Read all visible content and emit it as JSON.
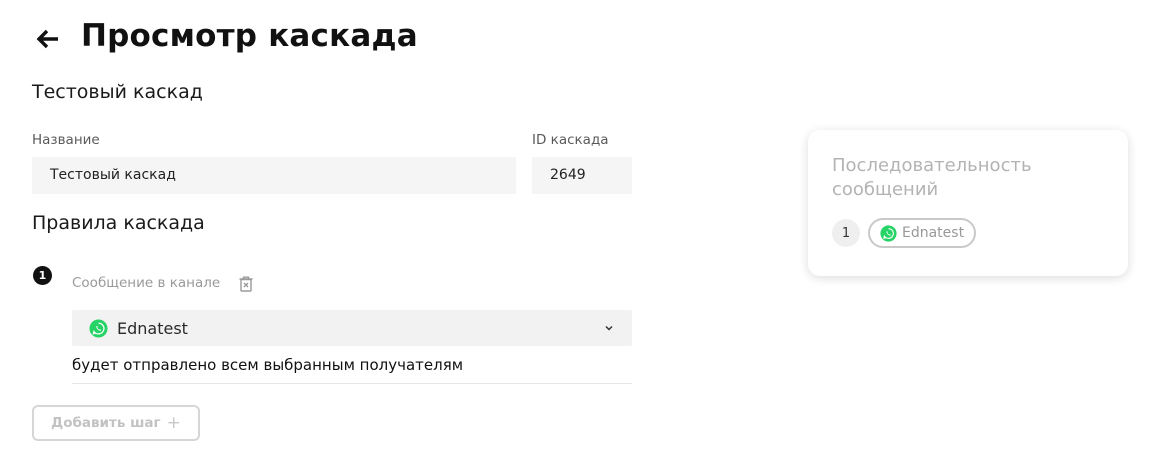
{
  "header": {
    "title": "Просмотр каскада"
  },
  "cascade": {
    "heading": "Тестовый каскад",
    "name_label": "Название",
    "name_value": "Тестовый каскад",
    "id_label": "ID каскада",
    "id_value": "2649"
  },
  "rules": {
    "heading": "Правила каскада",
    "steps": [
      {
        "number": "1",
        "label": "Сообщение в канале",
        "channel": "Ednatest",
        "channel_icon": "whatsapp-icon",
        "recipients_text": "будет отправлено всем выбранным получателям"
      }
    ],
    "add_step_label": "Добавить шаг",
    "add_step_icon": "+"
  },
  "sequence": {
    "title": "Последовательность сообщений",
    "items": [
      {
        "number": "1",
        "channel": "Ednatest",
        "channel_icon": "whatsapp-icon"
      }
    ]
  },
  "colors": {
    "whatsapp": "#25D366",
    "text_primary": "#111111",
    "muted": "#9a9a9a"
  }
}
